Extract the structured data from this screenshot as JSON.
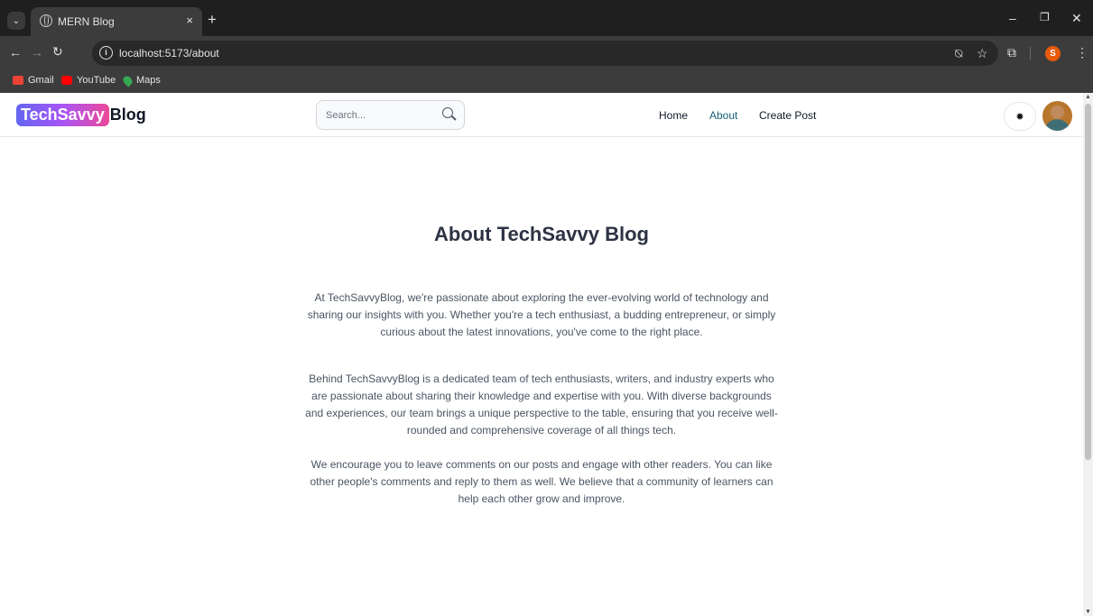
{
  "browser": {
    "tab_title": "MERN Blog",
    "tab_close": "×",
    "new_tab": "+",
    "url": "localhost:5173/about",
    "window_controls": {
      "minimize": "–",
      "restore": "❐",
      "close": "✕"
    },
    "bookmarks": [
      {
        "label": "Gmail",
        "icon": "gmail-icon",
        "color": "#ea4335"
      },
      {
        "label": "YouTube",
        "icon": "youtube-icon",
        "color": "#ff0000"
      },
      {
        "label": "Maps",
        "icon": "maps-icon",
        "color": "#34a853"
      }
    ],
    "profile_initial": "S"
  },
  "navbar": {
    "logo_brand": "TechSavvy",
    "logo_suffix": "Blog",
    "search_placeholder": "Search...",
    "links": {
      "home": "Home",
      "about": "About",
      "create_post": "Create Post"
    },
    "active_link": "About",
    "theme_icon": "✹"
  },
  "about": {
    "title": "About TechSavvy Blog",
    "paragraphs": [
      "At TechSavvyBlog, we're passionate about exploring the ever-evolving world of technology and sharing our insights with you. Whether you're a tech enthusiast, a budding entrepreneur, or simply curious about the latest innovations, you've come to the right place.",
      "Behind TechSavvyBlog is a dedicated team of tech enthusiasts, writers, and industry experts who are passionate about sharing their knowledge and expertise with you. With diverse backgrounds and experiences, our team brings a unique perspective to the table, ensuring that you receive well-rounded and comprehensive coverage of all things tech.",
      "We encourage you to leave comments on our posts and engage with other readers. You can like other people's comments and reply to them as well. We believe that a community of learners can help each other grow and improve."
    ]
  },
  "colors": {
    "accent_link": "#155e75",
    "brand_gradient_start": "#6366f1",
    "brand_gradient_end": "#ec4899"
  }
}
